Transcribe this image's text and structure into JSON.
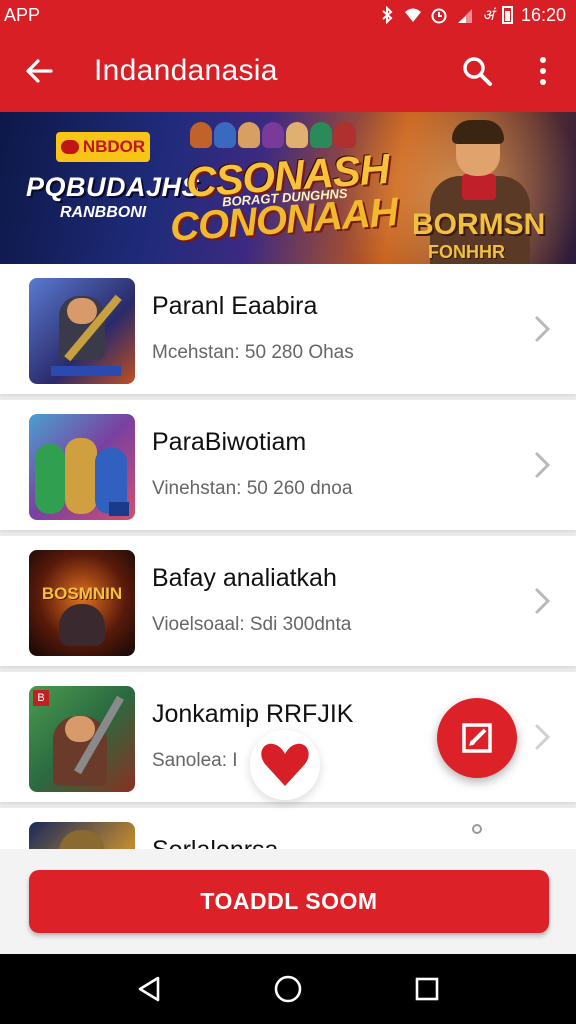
{
  "status_bar": {
    "carrier": "APP",
    "network_label": "अं",
    "time": "16:20"
  },
  "app_bar": {
    "title": "Indandanasia",
    "icons": [
      "back-arrow-icon",
      "search-icon",
      "more-vert-icon"
    ]
  },
  "banner": {
    "badge": "NBDOR",
    "left_title": "PQBUDAJHS",
    "left_sub": "RANBBONI",
    "center_title": "CSONASH",
    "center_tag": "BORAGT DUNGHNS",
    "center_title2": "CONONAAH",
    "right_title": "BORMSN",
    "right_sub": "FONHHR"
  },
  "games": [
    {
      "name": "Paranl Eaabira",
      "detail": "Mcehstan: 50 280 Ohas"
    },
    {
      "name": "ParaBiwotiam",
      "detail": "Vinehstan: 50 260 dnoa"
    },
    {
      "name": "Bafay analiatkah",
      "detail": "Vioelsoaal: Sdi 300dnta",
      "thumb_text": "BOSMNIN"
    },
    {
      "name": "Jonkamip RRFJIK",
      "detail": "Sanolea: I",
      "thumb_text": "B"
    },
    {
      "name": "Sorlalonrsa",
      "detail": ""
    }
  ],
  "fab": {
    "icon": "edit-icon"
  },
  "cta": {
    "label": "TOADDL SOOM"
  },
  "nav": {
    "icons": [
      "back-triangle-icon",
      "home-circle-icon",
      "recents-square-icon"
    ]
  },
  "colors": {
    "primary": "#d91f26",
    "accent": "#dd2128"
  }
}
